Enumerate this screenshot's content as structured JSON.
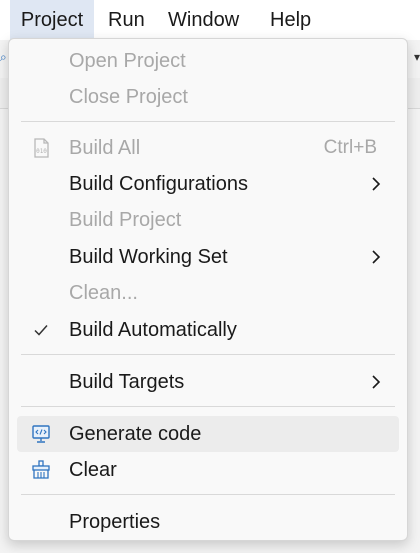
{
  "menubar": {
    "items": [
      {
        "label": "Project"
      },
      {
        "label": "Run"
      },
      {
        "label": "Window"
      },
      {
        "label": "Help"
      }
    ]
  },
  "project_menu": {
    "items": [
      {
        "label": "Open Project",
        "state": "disabled"
      },
      {
        "label": "Close Project",
        "state": "disabled"
      },
      {
        "label": "Build All",
        "shortcut": "Ctrl+B",
        "state": "disabled",
        "icon": "binary-file-icon"
      },
      {
        "label": "Build Configurations",
        "submenu": true
      },
      {
        "label": "Build Project",
        "state": "disabled"
      },
      {
        "label": "Build Working Set",
        "submenu": true
      },
      {
        "label": "Clean...",
        "state": "disabled"
      },
      {
        "label": "Build Automatically",
        "checked": true,
        "icon": "checkmark-icon"
      },
      {
        "label": "Build Targets",
        "submenu": true
      },
      {
        "label": "Generate code",
        "state": "hover",
        "icon": "generate-code-icon"
      },
      {
        "label": "Clear",
        "icon": "clear-icon"
      },
      {
        "label": "Properties"
      }
    ]
  },
  "colors": {
    "enabled_text": "#1a1a1a",
    "disabled_text": "#a8a8a8",
    "hover_background": "#ececec",
    "accent_icon": "#2f74c0",
    "active_menubar": "#dfe7f3"
  }
}
